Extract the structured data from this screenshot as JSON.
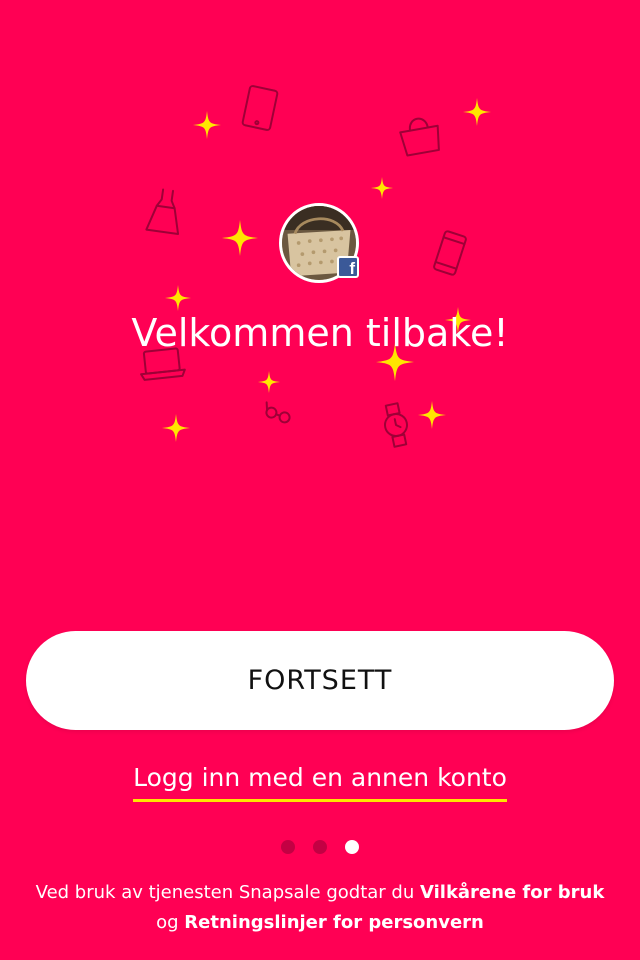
{
  "welcome": {
    "title": "Velkommen tilbake!"
  },
  "profile": {
    "badge_letter": "f",
    "badge_color": "#3B5998"
  },
  "actions": {
    "continue_label": "FORTSETT",
    "alt_login_label": "Logg inn med en annen konto"
  },
  "pager": {
    "count": 3,
    "active_index": 2
  },
  "terms": {
    "prefix": "Ved bruk av tjenesten Snapsale godtar du ",
    "terms_link": "Vilkårene for bruk",
    "middle": " og ",
    "privacy_link": "Retningslinjer for personvern"
  },
  "icons": [
    "tablet-icon",
    "handbag-icon",
    "dress-icon",
    "phone-icon",
    "laptop-icon",
    "glasses-icon",
    "watch-icon",
    "sparkle-icon"
  ],
  "colors": {
    "background": "#FF0054",
    "sparkle": "#FFE600",
    "underline": "#FFE600",
    "button": "#FFFFFF",
    "dot_inactive": "#C30043",
    "dot_active": "#FFFFFF"
  }
}
